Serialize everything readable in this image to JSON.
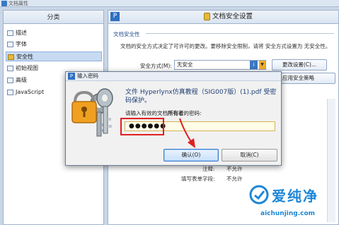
{
  "window": {
    "title": "文档属性"
  },
  "left_panel": {
    "header": "分类",
    "items": [
      {
        "label": "描述",
        "active": false
      },
      {
        "label": "字体",
        "active": false
      },
      {
        "label": "安全性",
        "active": true
      },
      {
        "label": "初始视图",
        "active": false
      },
      {
        "label": "高级",
        "active": false
      },
      {
        "label": "JavaScript",
        "active": false
      }
    ]
  },
  "right_panel": {
    "header": "文档安全设置",
    "section_title": "文档安全性",
    "description": "文档的安全方式决定了可许可的更改。要移除安全限制，请将 安全方式设置为 无安全性。",
    "security_method_label": "安全方式(M):",
    "security_method_value": "无安全",
    "change_settings_button": "更改设置(C)...",
    "apply_policy_button": "应用安全策略",
    "rows": [
      {
        "label": "注释:",
        "value": "不允许"
      },
      {
        "label": "填写表单字段:",
        "value": "不允许"
      }
    ]
  },
  "dialog": {
    "title": "输入密码",
    "message": "文件 Hyperlynx仿真教程（SIG007版）(1).pdf 受密码保护。",
    "prompt_prefix": "请输入有效的文档",
    "prompt_bold": "所有者",
    "prompt_suffix": "的密码:",
    "password_value": "●●●●●●",
    "ok_button": "确认(O)",
    "cancel_button": "取消(C)"
  },
  "watermark": {
    "text": "爱纯净",
    "url": "aichunjing.com"
  },
  "colors": {
    "accent": "#3a78c2",
    "highlight": "#e02020",
    "watermark": "#1d86d6"
  }
}
